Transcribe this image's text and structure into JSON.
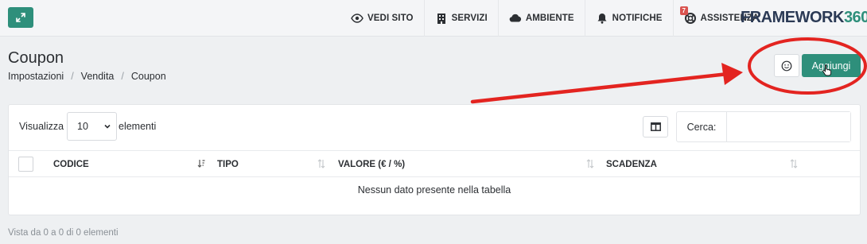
{
  "topbar": {
    "nav": [
      {
        "label": "VEDI SITO",
        "icon": "eye-icon"
      },
      {
        "label": "SERVIZI",
        "icon": "building-icon"
      },
      {
        "label": "AMBIENTE",
        "icon": "cloud-icon"
      },
      {
        "label": "NOTIFICHE",
        "icon": "bell-icon"
      },
      {
        "label": "ASSISTENZA",
        "icon": "lifebuoy-icon",
        "badge": "7"
      }
    ],
    "brand": {
      "text": "FRAMEWORK",
      "number": "360"
    }
  },
  "header": {
    "title": "Coupon",
    "breadcrumb": [
      "Impostazioni",
      "Vendita",
      "Coupon"
    ],
    "add_label": "Aggiungi"
  },
  "table": {
    "length_label": "Visualizza",
    "length_value": "10",
    "length_after": "elementi",
    "search_label": "Cerca:",
    "search_value": "",
    "columns": [
      "CODICE",
      "TIPO",
      "VALORE (€ / %)",
      "SCADENZA"
    ],
    "empty_message": "Nessun dato presente nella tabella",
    "info": "Vista da 0 a 0 di 0 elementi"
  },
  "colors": {
    "accent": "#2e8f7b",
    "annotation": "#e32420"
  }
}
